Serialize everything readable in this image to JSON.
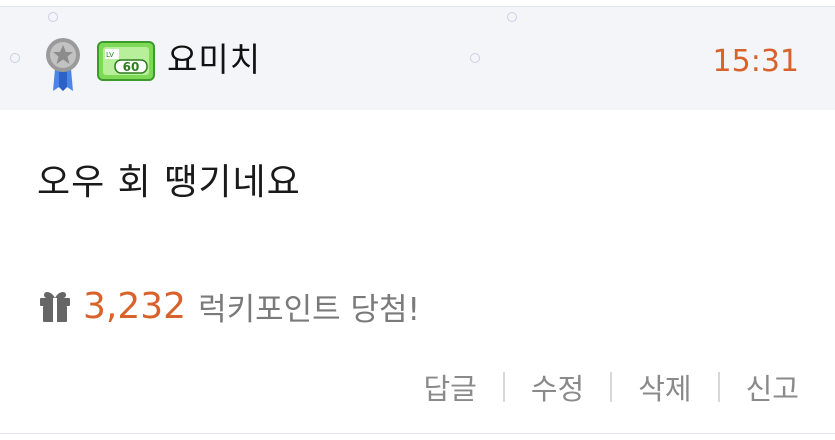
{
  "comment": {
    "nickname": "요미치",
    "time": "15:31",
    "text": "오우 회 땡기네요",
    "level_badge": "LV60",
    "prize": {
      "points": "3,232",
      "text": "럭키포인트 당첨!"
    },
    "actions": {
      "reply": "답글",
      "edit": "수정",
      "delete": "삭제",
      "report": "신고"
    }
  },
  "colors": {
    "accent": "#d9622a",
    "header_bg": "#f3f5f9",
    "muted_text": "#8a8a8a"
  },
  "icons": [
    "medal-icon",
    "level-badge-icon",
    "gift-icon"
  ]
}
